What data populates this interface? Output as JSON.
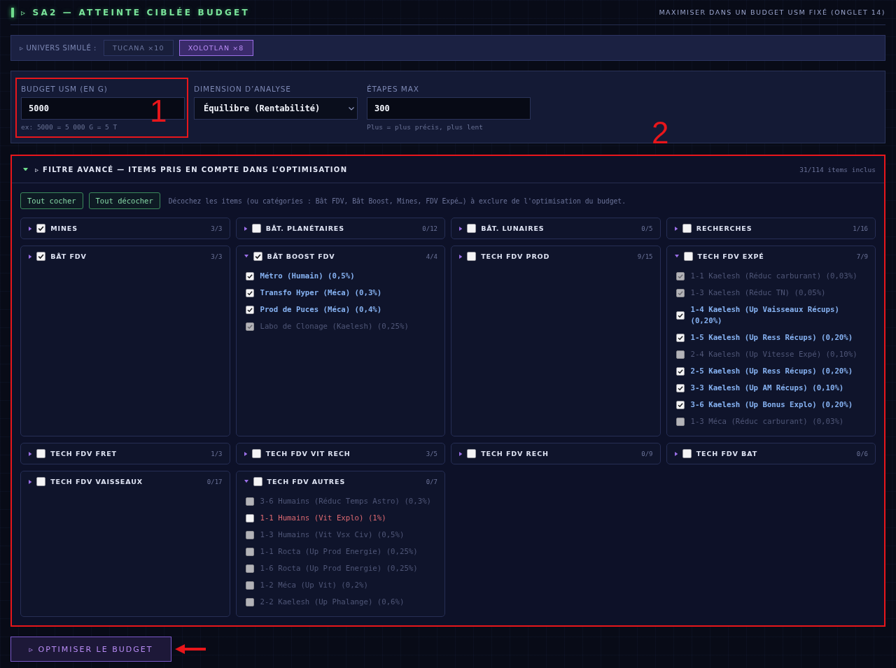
{
  "header": {
    "title": "▹ SA2 — ATTEINTE CIBLÉE BUDGET",
    "subtitle": "MAXIMISER DANS UN BUDGET USM FIXÉ (ONGLET 14)"
  },
  "universe": {
    "label": "▹ UNIVERS SIMULÉ :",
    "options": [
      {
        "label": "TUCANA ×10",
        "selected": false
      },
      {
        "label": "XOLOTLAN ×8",
        "selected": true
      }
    ]
  },
  "settings": [
    {
      "kind": "input",
      "label": "BUDGET USM (EN G)",
      "value": "5000",
      "hint": "ex: 5000 = 5 000 G = 5 T",
      "annotation": "1"
    },
    {
      "kind": "select",
      "label": "DIMENSION D’ANALYSE",
      "value": "Équilibre (Rentabilité)"
    },
    {
      "kind": "input",
      "label": "ÉTAPES MAX",
      "value": "300",
      "hint": "Plus = plus précis, plus lent"
    }
  ],
  "filter": {
    "expanded": true,
    "title": "▹ FILTRE AVANCÉ — ITEMS PRIS EN COMPTE DANS L’OPTIMISATION",
    "count": "31/114 items inclus",
    "annotation": "2",
    "buttons": [
      "Tout cocher",
      "Tout décocher"
    ],
    "hint": "Décochez les items (ou catégories : Bât FDV, Bât Boost, Mines, FDV Expé…) à exclure de l'optimisation du budget.",
    "groups": [
      {
        "title": "MINES",
        "count": "3/3",
        "checked": true,
        "expanded": false
      },
      {
        "title": "BÂT. PLANÉTAIRES",
        "count": "0/12",
        "checked": false,
        "expanded": false
      },
      {
        "title": "BÂT. LUNAIRES",
        "count": "0/5",
        "checked": false,
        "expanded": false
      },
      {
        "title": "RECHERCHES",
        "count": "1/16",
        "checked": false,
        "expanded": false
      },
      {
        "title": "BÂT FDV",
        "count": "3/3",
        "checked": true,
        "expanded": false
      },
      {
        "title": "BÂT BOOST FDV",
        "count": "4/4",
        "checked": true,
        "expanded": true,
        "items": [
          {
            "label": "Métro (Humain) (0,5%)",
            "checked": true,
            "disabled": false
          },
          {
            "label": "Transfo Hyper (Méca) (0,3%)",
            "checked": true,
            "disabled": false
          },
          {
            "label": "Prod de Puces (Méca) (0,4%)",
            "checked": true,
            "disabled": false
          },
          {
            "label": "Labo de Clonage (Kaelesh) (0,25%)",
            "checked": true,
            "disabled": true
          }
        ]
      },
      {
        "title": "TECH FDV PROD",
        "count": "9/15",
        "checked": false,
        "expanded": false
      },
      {
        "title": "TECH FDV EXPÉ",
        "count": "7/9",
        "checked": false,
        "expanded": true,
        "items": [
          {
            "label": "1-1 Kaelesh (Réduc carburant) (0,03%)",
            "checked": true,
            "disabled": true
          },
          {
            "label": "1-3 Kaelesh (Réduc TN) (0,05%)",
            "checked": true,
            "disabled": true
          },
          {
            "label": "1-4 Kaelesh (Up Vaisseaux Récups) (0,20%)",
            "checked": true,
            "disabled": false
          },
          {
            "label": "1-5 Kaelesh (Up Ress Récups) (0,20%)",
            "checked": true,
            "disabled": false
          },
          {
            "label": "2-4 Kaelesh (Up Vitesse Expé) (0,10%)",
            "checked": false,
            "disabled": true
          },
          {
            "label": "2-5 Kaelesh (Up Ress Récups) (0,20%)",
            "checked": true,
            "disabled": false
          },
          {
            "label": "3-3 Kaelesh (Up AM Récups) (0,10%)",
            "checked": true,
            "disabled": false
          },
          {
            "label": "3-6 Kaelesh (Up Bonus Explo) (0,20%)",
            "checked": true,
            "disabled": false
          },
          {
            "label": "1-3 Méca (Réduc carburant) (0,03%)",
            "checked": false,
            "disabled": true
          }
        ]
      },
      {
        "title": "TECH FDV FRET",
        "count": "1/3",
        "checked": false,
        "expanded": false
      },
      {
        "title": "TECH FDV VIT RECH",
        "count": "3/5",
        "checked": false,
        "expanded": false
      },
      {
        "title": "TECH FDV RECH",
        "count": "0/9",
        "checked": false,
        "expanded": false
      },
      {
        "title": "TECH FDV BAT",
        "count": "0/6",
        "checked": false,
        "expanded": false
      },
      {
        "title": "TECH FDV VAISSEAUX",
        "count": "0/17",
        "checked": false,
        "expanded": false
      },
      {
        "title": "TECH FDV AUTRES",
        "count": "0/7",
        "checked": false,
        "expanded": true,
        "items": [
          {
            "label": "3-6 Humains (Réduc Temps Astro) (0,3%)",
            "checked": false,
            "disabled": true
          },
          {
            "label": "1-1 Humains (Vit Explo) (1%)",
            "checked": false,
            "disabled": false
          },
          {
            "label": "1-3 Humains (Vit Vsx Civ) (0,5%)",
            "checked": false,
            "disabled": true
          },
          {
            "label": "1-1 Rocta (Up Prod Energie) (0,25%)",
            "checked": false,
            "disabled": true
          },
          {
            "label": "1-6 Rocta (Up Prod Energie) (0,25%)",
            "checked": false,
            "disabled": true
          },
          {
            "label": "1-2 Méca (Up Vit) (0,2%)",
            "checked": false,
            "disabled": true
          },
          {
            "label": "2-2 Kaelesh (Up Phalange) (0,6%)",
            "checked": false,
            "disabled": true
          }
        ]
      }
    ]
  },
  "run_button": {
    "label": "▹ OPTIMISER LE BUDGET",
    "arrow": true
  }
}
